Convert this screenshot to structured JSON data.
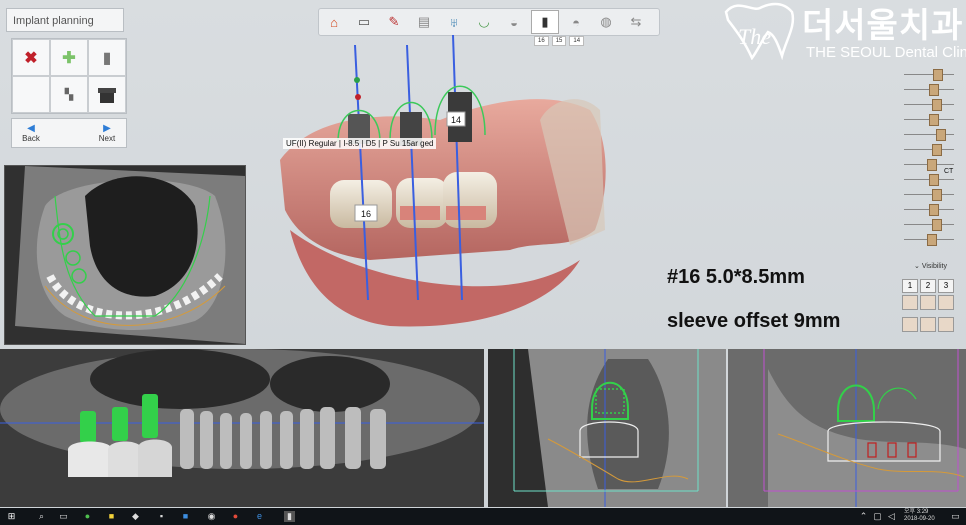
{
  "app": {
    "panel_title": "Implant planning"
  },
  "nav": {
    "back": "Back",
    "next": "Next"
  },
  "tooth_numbers": [
    "16",
    "15",
    "14"
  ],
  "logo": {
    "korean": "더서울치과",
    "english": "THE SEOUL Dental Clinic"
  },
  "implant_label": "UF(II) Regular | I-8.5 | D5 | P Su 15ar ged",
  "implant_numbers": {
    "left": "16",
    "right": "14"
  },
  "annotation": {
    "line1": "#16 5.0*8.5mm",
    "line2": "sleeve offset 9mm"
  },
  "sidebar": {
    "ct_label": "CT",
    "visibility_label": "Visibility",
    "layout_nums": [
      "1",
      "2",
      "3"
    ]
  },
  "sliders": [
    0.62,
    0.55,
    0.6,
    0.55,
    0.7,
    0.6,
    0.5,
    0.55,
    0.6,
    0.55,
    0.6,
    0.5
  ],
  "taskbar": {
    "time": "오후 3:29",
    "date": "2018-09-20"
  },
  "colors": {
    "accent": "#2e7dd6",
    "implant_green": "#33d04a",
    "nerve_orange": "#d59a3a",
    "cut_line_blue": "#3a5fe0"
  }
}
